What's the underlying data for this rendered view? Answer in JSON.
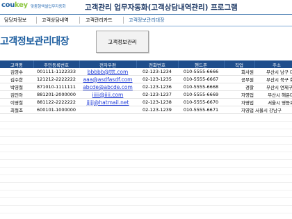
{
  "header": {
    "logo_main": "cou",
    "logo_key": "key",
    "logo_sub": "맞춤형엑셀업무자동화",
    "title": "고객관리 업무자동화(고객상담내역관리) 프로그램"
  },
  "tabs": [
    {
      "label": "담당자정보"
    },
    {
      "label": "고객상담내역"
    },
    {
      "label": "고객관리카드"
    },
    {
      "label": "고객정보관리대장"
    }
  ],
  "page": {
    "title": "고객정보관리대장",
    "button_label": "고객정보관리"
  },
  "table": {
    "columns": [
      "고객명",
      "주민등록번호",
      "전자우편",
      "전화번호",
      "핸드폰",
      "직업",
      "주소"
    ],
    "rows": [
      {
        "name": "김영수",
        "rrn": "001111-1122333",
        "email": "bbbbb@ttt.com",
        "phone": "02-123-1234",
        "mobile": "010-5555-6666",
        "job": "회사원",
        "address": "부산시 남구 대연"
      },
      {
        "name": "김수한",
        "rrn": "121212-2222222",
        "email": "aaa@asdfasdf.com",
        "phone": "02-123-1235",
        "mobile": "010-5555-6667",
        "job": "공무원",
        "address": "부산시 북구 화명"
      },
      {
        "name": "박영철",
        "rrn": "871010-1111111",
        "email": "abcde@abcde.com",
        "phone": "02-123-1236",
        "mobile": "010-5555-6668",
        "job": "경찰",
        "address": "부산시 연제구 연"
      },
      {
        "name": "김민아",
        "rrn": "881201-2000000",
        "email": "iiiii@iiii.com",
        "phone": "02-123-1237",
        "mobile": "010-5555-6669",
        "job": "자영업",
        "address": "부산시 해운대구"
      },
      {
        "name": "이영철",
        "rrn": "881122-2222222",
        "email": "jjjjj@hatmail.net",
        "phone": "02-123-1238",
        "mobile": "010-5555-6670",
        "job": "자영업",
        "address": "서울시 영등포구"
      },
      {
        "name": "최철조",
        "rrn": "600101-1000000",
        "email": "",
        "phone": "02-123-1239",
        "mobile": "010-5555-6671",
        "job": "자영업",
        "address": "서울시 강남구"
      }
    ]
  },
  "colors": {
    "brand_blue": "#1f5fa0",
    "header_fill": "#1f4e8c",
    "logo_green": "#8cc63f",
    "link_blue": "#1f3bd8"
  }
}
